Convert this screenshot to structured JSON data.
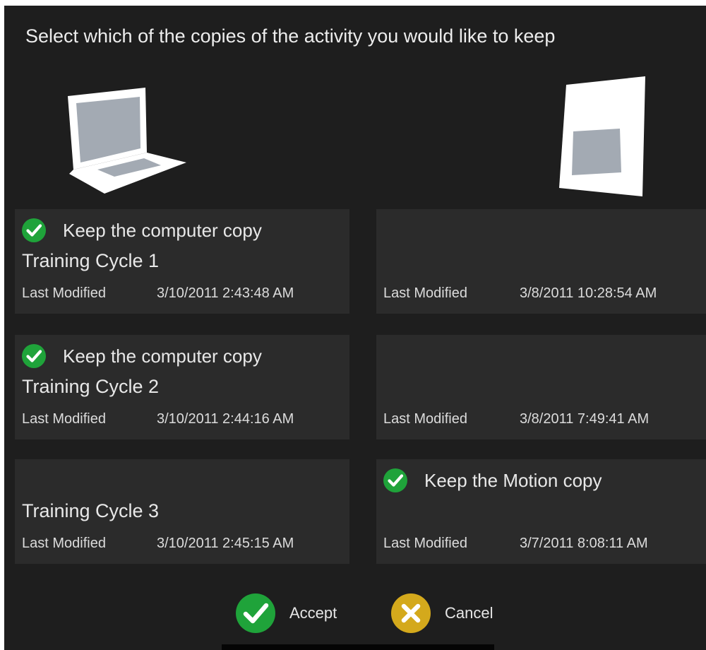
{
  "dialog": {
    "title": "Select which of the copies of the activity you would like to keep"
  },
  "devices": {
    "computer_icon": "laptop-icon",
    "motion_icon": "tablet-icon"
  },
  "rows": [
    {
      "left": {
        "selected": true,
        "keep_label": "Keep the computer copy",
        "activity_name": "Training Cycle 1",
        "last_modified_label": "Last Modified",
        "last_modified_value": "3/10/2011 2:43:48 AM"
      },
      "right": {
        "selected": false,
        "last_modified_label": "Last Modified",
        "last_modified_value": "3/8/2011 10:28:54 AM"
      }
    },
    {
      "left": {
        "selected": true,
        "keep_label": "Keep the computer copy",
        "activity_name": "Training Cycle 2",
        "last_modified_label": "Last Modified",
        "last_modified_value": "3/10/2011 2:44:16 AM"
      },
      "right": {
        "selected": false,
        "last_modified_label": "Last Modified",
        "last_modified_value": "3/8/2011 7:49:41 AM"
      }
    },
    {
      "left": {
        "selected": false,
        "activity_name": "Training Cycle 3",
        "last_modified_label": "Last Modified",
        "last_modified_value": "3/10/2011 2:45:15 AM"
      },
      "right": {
        "selected": true,
        "keep_label": "Keep the Motion copy",
        "last_modified_label": "Last Modified",
        "last_modified_value": "3/7/2011 8:08:11 AM"
      }
    }
  ],
  "buttons": {
    "accept_label": "Accept",
    "cancel_label": "Cancel"
  },
  "colors": {
    "background": "#1e1e1e",
    "panel": "#2b2b2b",
    "check_green": "#1fa33a",
    "cancel_gold": "#d4a91c",
    "text": "#e8e8e8"
  }
}
